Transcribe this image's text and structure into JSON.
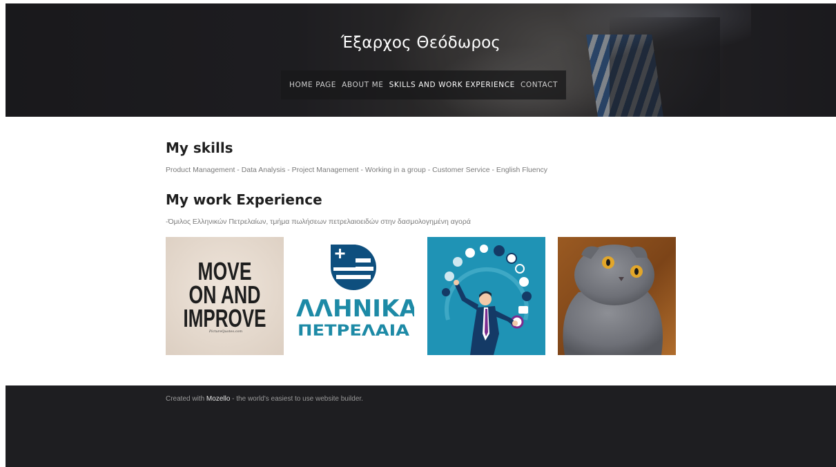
{
  "header": {
    "site_title": "Έξαρχος Θεόδωρος",
    "nav": [
      {
        "label": "HOME PAGE",
        "active": false
      },
      {
        "label": "ABOUT ME",
        "active": false
      },
      {
        "label": "SKILLS AND WORK EXPERIENCE",
        "active": true
      },
      {
        "label": "CONTACT",
        "active": false
      }
    ]
  },
  "main": {
    "skills_heading": "My skills",
    "skills_text": "Product Management - Data Analysis - Project Management - Working in a group - Customer Service - English Fluency",
    "work_heading": "My work Experience",
    "work_text": "-Όμιλος Ελληνικών Πετρελαίων, τμήμα πωλήσεων πετρελαιοειδών στην δασμολογημένη αγορά",
    "gallery": [
      {
        "name": "move-on-and-improve-quote",
        "lines": [
          "MOVE",
          "ON AND",
          "IMPROVE"
        ],
        "caption": "PictureQuotes.com"
      },
      {
        "name": "hellenic-petroleum-logo",
        "lines": [
          "ΛΛΗΝΙΚΑ",
          "ΠΕΤΡΕΛΑΙΑ"
        ]
      },
      {
        "name": "businessman-juggling-icons-illustration"
      },
      {
        "name": "scottish-fold-cat-photo"
      }
    ]
  },
  "footer": {
    "prefix": "Created with ",
    "brand": "Mozello",
    "suffix": " - the world's easiest to use website builder."
  },
  "colors": {
    "header_bg": "#1d1c1f",
    "footer_bg": "#1e1e21",
    "heading": "#1e1e1e",
    "body_text": "#7a7a7a",
    "illustration_bg": "#1f93b5",
    "logo_blue": "#0e4f7e",
    "logo_teal": "#1d8aa6"
  }
}
